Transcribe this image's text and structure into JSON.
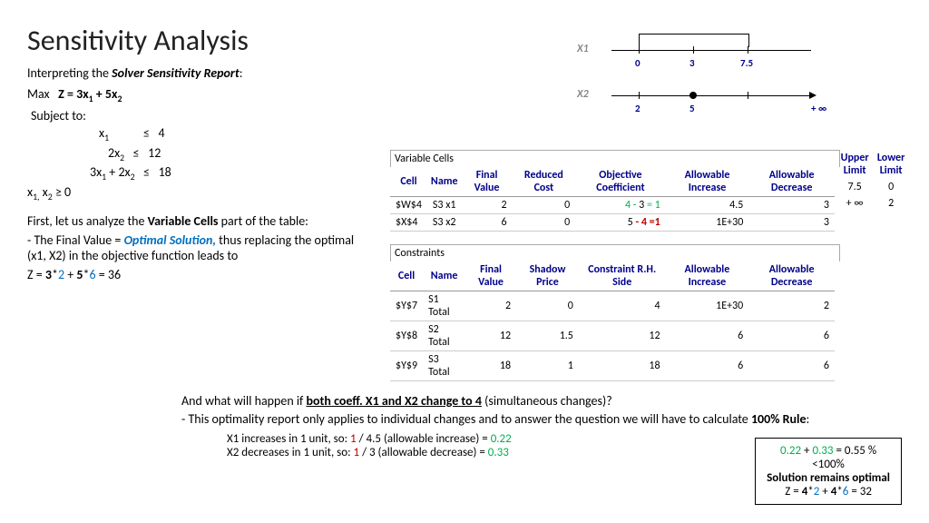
{
  "title": "Sensitivity Analysis",
  "intro_pre": "Interpreting the ",
  "intro_bold": "Solver Sensitivity Report",
  "intro_post": ":",
  "obj_pre": "Max   ",
  "obj_bold": "Z = 3x",
  "obj_mid": " + 5x",
  "subject": "Subject to:",
  "c1_var": "x",
  "c1_sub": "1",
  "c1_op": "≤",
  "c1_rhs": "4",
  "c2_var": "2x",
  "c2_sub": "2",
  "c2_op": "≤",
  "c2_rhs": "12",
  "c3_pre": "3x",
  "c3_sub1": "1",
  "c3_mid": " + 2x",
  "c3_sub2": "2",
  "c3_op": "≤",
  "c3_rhs": "18",
  "nonneg_pre": "x",
  "nonneg_s1": "1,",
  "nonneg_mid": " x",
  "nonneg_s2": "2",
  "nonneg_post": " ≥ 0",
  "analysis1_pre": "First, let us analyze the ",
  "analysis1_bold": "Variable Cells",
  "analysis1_post": " part of the table:",
  "analysis2_pre": "- The Final Value = ",
  "analysis2_blue": "Optimal Solution,",
  "analysis2_post": " thus replacing the optimal (x1, X2) in the objective function leads to",
  "zline_pre": "Z = ",
  "z_b1": "3",
  "z_star1": "*",
  "z_v1": "2",
  "z_plus": " + ",
  "z_b2": "5",
  "z_star2": "*",
  "z_v2": "6",
  "z_eq": " = 36",
  "axis1_label": "X1",
  "axis1_n0": "0",
  "axis1_n1": "3",
  "axis1_n2": "7.5",
  "axis2_label": "X2",
  "axis2_n0": "2",
  "axis2_n1": "5",
  "axis2_n2": "+ ∞",
  "sec_var": "Variable Cells",
  "h_cell": "Cell",
  "h_name": "Name",
  "h_fv": "Final Value",
  "h_rc": "Reduced Cost",
  "h_oc": "Objective Coefficient",
  "h_ai": "Allowable Increase",
  "h_ad": "Allowable Decrease",
  "h_ul": "Upper Limit",
  "h_ll": "Lower Limit",
  "r1_cell": "$W$4",
  "r1_name": "S3 x1",
  "r1_fv": "2",
  "r1_rc": "0",
  "r1_oc_a": "4 -",
  "r1_oc_b": "  3 ",
  "r1_oc_c": "= 1",
  "r1_ai": "4.5",
  "r1_ad": "3",
  "r1_ul": "7.5",
  "r1_ll": "0",
  "r2_cell": "$X$4",
  "r2_name": "S3 x2",
  "r2_fv": "6",
  "r2_rc": "0",
  "r2_oc_a": "5 ",
  "r2_oc_b": "- 4 =1",
  "r2_ai": "1E+30",
  "r2_ad": "3",
  "r2_ul": "+ ∞",
  "r2_ll": "2",
  "sec_con": "Constraints",
  "h_sp": "Shadow Price",
  "h_rhs": "Constraint R.H. Side",
  "cr1_cell": "$Y$7",
  "cr1_name": "S1 Total",
  "cr1_fv": "2",
  "cr1_sp": "0",
  "cr1_rhs": "4",
  "cr1_ai": "1E+30",
  "cr1_ad": "2",
  "cr2_cell": "$Y$8",
  "cr2_name": "S2 Total",
  "cr2_fv": "12",
  "cr2_sp": "1.5",
  "cr2_rhs": "12",
  "cr2_ai": "6",
  "cr2_ad": "6",
  "cr3_cell": "$Y$9",
  "cr3_name": "S3 Total",
  "cr3_fv": "18",
  "cr3_sp": "1",
  "cr3_rhs": "18",
  "cr3_ai": "6",
  "cr3_ad": "6",
  "q_pre": "And what will happen if ",
  "q_bold": "both coeff. X1 and X2 change to 4",
  "q_post": " (simultaneous changes)?",
  "rule_pre": "- This optimality report only applies to individual changes and to answer the question we will have to calculate ",
  "rule_bold": "100% Rule",
  "rule_post": ":",
  "calc1_pre": "X1 increases in 1 unit, so:  ",
  "calc1_r": "1",
  "calc1_mid": " / 4.5 (allowable increase) = ",
  "calc1_g": "0.22",
  "calc2_pre": "X2 decreases in 1 unit, so: ",
  "calc2_r": "1",
  "calc2_mid": " / 3 (allowable decrease) = ",
  "calc2_g": "0.33",
  "box_l1_a": "0.22",
  "box_l1_plus": " + ",
  "box_l1_b": "0.33",
  "box_l1_eq": " = 0.55 %",
  "box_l2": "<100%",
  "box_l3": "Solution remains optimal",
  "box_l4_pre": "Z = ",
  "box_l4_b1": "4",
  "box_l4_s1": "*",
  "box_l4_v1": "2",
  "box_l4_plus": " + ",
  "box_l4_b2": "4",
  "box_l4_s2": "*",
  "box_l4_v2": "6",
  "box_l4_eq": " = 32"
}
